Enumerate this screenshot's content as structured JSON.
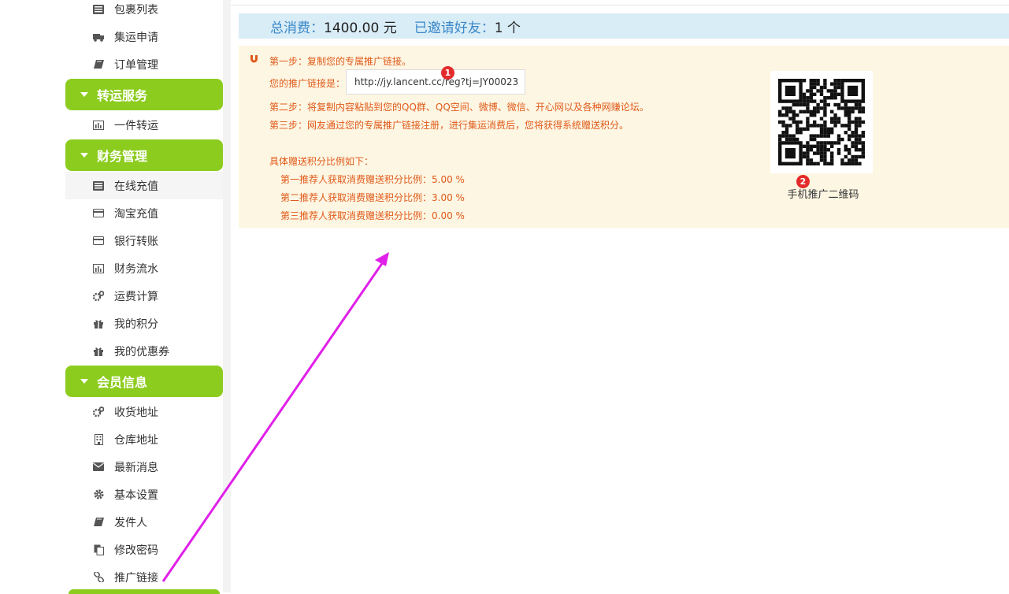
{
  "sidebar": {
    "items_top": [
      {
        "label": "包裹列表",
        "icon": "list-icon"
      },
      {
        "label": "集运申请",
        "icon": "truck-icon"
      },
      {
        "label": "订单管理",
        "icon": "book-icon"
      }
    ],
    "groups": [
      {
        "title": "转运服务",
        "items": [
          {
            "label": "一件转运",
            "icon": "bar-chart-icon"
          }
        ]
      },
      {
        "title": "财务管理",
        "items": [
          {
            "label": "在线充值",
            "icon": "list-icon"
          },
          {
            "label": "淘宝充值",
            "icon": "card-icon"
          },
          {
            "label": "银行转账",
            "icon": "card-icon"
          },
          {
            "label": "财务流水",
            "icon": "bar-chart-icon"
          },
          {
            "label": "运费计算",
            "icon": "gears-icon"
          },
          {
            "label": "我的积分",
            "icon": "gift-icon"
          },
          {
            "label": "我的优惠券",
            "icon": "gift-icon"
          }
        ]
      },
      {
        "title": "会员信息",
        "items": [
          {
            "label": "收货地址",
            "icon": "gears-icon"
          },
          {
            "label": "仓库地址",
            "icon": "building-icon"
          },
          {
            "label": "最新消息",
            "icon": "envelope-icon"
          },
          {
            "label": "基本设置",
            "icon": "gear-icon"
          },
          {
            "label": "发件人",
            "icon": "book-icon"
          },
          {
            "label": "修改密码",
            "icon": "copy-icon"
          },
          {
            "label": "推广链接",
            "icon": "link-icon"
          }
        ]
      }
    ]
  },
  "summary": {
    "total_label": "总消费：",
    "total_value": "1400.00 元",
    "invited_label": "已邀请好友：",
    "invited_value": "1 个"
  },
  "panel": {
    "step1": "第一步：复制您的专属推广链接。",
    "link_label": "您的推广链接是：",
    "link_value": "http://jy.lancent.cc/reg?tj=JY00023",
    "step2": "第二步：将复制内容粘贴到您的QQ群、QQ空间、微博、微信、开心网以及各种网赚论坛。",
    "step3": "第三步：网友通过您的专属推广链接注册，进行集运消费后，您将获得系统赠送积分。",
    "ratio_title": "具体赠送积分比例如下：",
    "ratios": [
      "第一推荐人获取消费赠送积分比例：5.00 %",
      "第二推荐人获取消费赠送积分比例：3.00 %",
      "第三推荐人获取消费赠送积分比例：0.00 %"
    ],
    "qr_label": "手机推广二维码"
  },
  "annotations": {
    "badge1": "1",
    "badge2": "2",
    "arrow_color": "#e020e8"
  },
  "colors": {
    "green": "#8ccc1f",
    "summary_bg": "#d9edf7",
    "panel_bg": "#fdf6e3",
    "step_text": "#e05a1a"
  }
}
